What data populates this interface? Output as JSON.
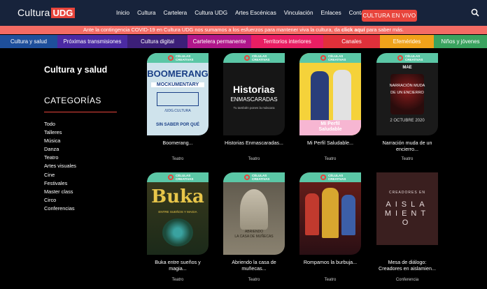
{
  "header": {
    "logo_word": "Cultura",
    "logo_udg": "UDG",
    "nav": [
      "Inicio",
      "Cultura",
      "Cartelera",
      "Cultura UDG",
      "Artes Escénicas",
      "Vinculación",
      "Enlaces",
      "Contacto"
    ],
    "live_button": "CULTURA EN VIVO",
    "search_icon": "search-icon"
  },
  "announcement": {
    "before": "Ante la contingencia COVID-19 en Cultura UDG nos sumamos a los esfuerzos para mantener viva la cultura, da ",
    "link": "click aquí",
    "after": " para saber más."
  },
  "category_bar": [
    {
      "label": "Cultura y salud",
      "color": "#1e4f9b"
    },
    {
      "label": "Próximas transmisiones",
      "color": "#4b2aa3"
    },
    {
      "label": "Cultura digital",
      "color": "#3c1f78"
    },
    {
      "label": "Cartelera permanente",
      "color": "#b0168a"
    },
    {
      "label": "Territorios interiores",
      "color": "#e91e63"
    },
    {
      "label": "Canales",
      "color": "#e0303a"
    },
    {
      "label": "Efemérides",
      "color": "#f0a21a"
    },
    {
      "label": "Niños y jóvenes",
      "color": "#3aa35f"
    }
  ],
  "sidebar": {
    "title": "Cultura y salud",
    "categories_title": "CATEGORÍAS",
    "categories": [
      "Todo",
      "Talleres",
      "Música",
      "Danza",
      "Teatro",
      "Artes visuales",
      "Cine",
      "Festivales",
      "Master class",
      "Circo",
      "Conferencias"
    ]
  },
  "badge": {
    "line1": "CÉLULAS",
    "line2": "CREATIVAS"
  },
  "cards": [
    {
      "title": "Boomerang...",
      "category": "Teatro",
      "poster_text": "BOOMERANG",
      "poster_sub": "MOCKUMENTARY",
      "poster_foot": "SIN SABER POR QUÉ",
      "poster_extra": "/UDG.CULTURA"
    },
    {
      "title": "Historias Enmascaradas...",
      "category": "Teatro",
      "poster_text": "Historias",
      "poster_sub": "ENMASCARADAS",
      "poster_foot": "Tu también pones la máscara",
      "poster_extra": ""
    },
    {
      "title": "Mi Perfil Saludable...",
      "category": "Teatro",
      "poster_text": "Mi Perfil",
      "poster_sub": "Saludable",
      "poster_foot": "",
      "poster_extra": ""
    },
    {
      "title": "Narración muda de un encierro...",
      "category": "Teatro",
      "poster_text": "NARRACIÓN MUDA",
      "poster_sub": "DE UN ENCIERRO",
      "poster_foot": "2 OCTUBRE 2020",
      "poster_extra": "MAE"
    },
    {
      "title": "Buka entre sueños y magia...",
      "category": "Teatro",
      "poster_text": "Buka",
      "poster_sub": "ENTRE SUEÑOS Y MAGIA",
      "poster_foot": "",
      "poster_extra": ""
    },
    {
      "title": "Abriendo la casa de muñecas...",
      "category": "Teatro",
      "poster_text": "ABRIENDO",
      "poster_sub": "LA CASA DE MUÑECAS",
      "poster_foot": "",
      "poster_extra": ""
    },
    {
      "title": "Rompamos la burbuja...",
      "category": "Teatro",
      "poster_text": "",
      "poster_sub": "",
      "poster_foot": "",
      "poster_extra": ""
    },
    {
      "title": "Mesa de diálogo: Creadores en aislamien...",
      "category": "Conferencia",
      "poster_text": "CREADORES EN",
      "poster_sub": "AISLAMIENTO",
      "poster_foot": "",
      "poster_extra": ""
    }
  ]
}
